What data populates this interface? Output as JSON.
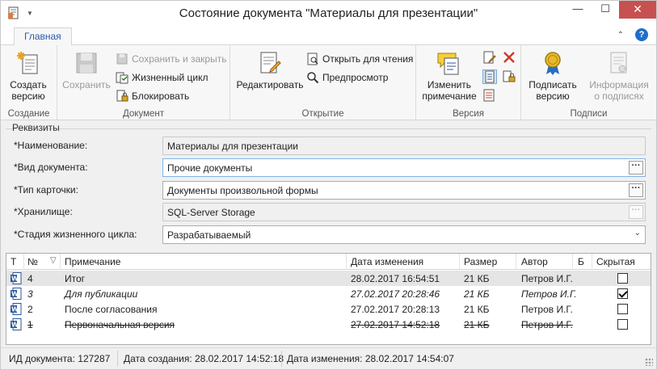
{
  "window": {
    "title": "Состояние документа \"Материалы для презентации\"",
    "minimize_glyph": "—",
    "maximize_glyph": "☐",
    "close_glyph": "✕"
  },
  "ribbon": {
    "tab_main": "Главная",
    "help_glyph": "?",
    "collapse_glyph": "⌃",
    "groups": {
      "create": "Создание",
      "document": "Документ",
      "open": "Открытие",
      "version": "Версия",
      "signatures": "Подписи"
    },
    "buttons": {
      "create_version_1": "Создать",
      "create_version_2": "версию",
      "save": "Сохранить",
      "save_and_close": "Сохранить и закрыть",
      "lifecycle": "Жизненный цикл",
      "lock": "Блокировать",
      "edit": "Редактировать",
      "open_read": "Открыть для чтения",
      "preview": "Предпросмотр",
      "change_note_1": "Изменить",
      "change_note_2": "примечание",
      "sign_1": "Подписать",
      "sign_2": "версию",
      "sign_info_1": "Информация",
      "sign_info_2": "о подписях"
    }
  },
  "requisites": {
    "caption": "Реквизиты",
    "fields": [
      {
        "label": "*Наименование:",
        "value": "Материалы для презентации"
      },
      {
        "label": "*Вид документа:",
        "value": "Прочие документы"
      },
      {
        "label": "*Тип карточки:",
        "value": "Документы произвольной формы"
      },
      {
        "label": "*Хранилище:",
        "value": "SQL-Server Storage"
      },
      {
        "label": "*Стадия жизненного цикла:",
        "value": "Разрабатываемый"
      }
    ],
    "ellipsis": "···",
    "dropdown_glyph": "⌄"
  },
  "table": {
    "columns": {
      "type": "Т",
      "num": "№",
      "sort": "▽",
      "note": "Примечание",
      "date": "Дата изменения",
      "size": "Размер",
      "author": "Автор",
      "b": "Б",
      "hidden": "Скрытая"
    },
    "rows": [
      {
        "num": "4",
        "note": "Итог",
        "date": "28.02.2017 16:54:51",
        "size": "21 КБ",
        "author": "Петров И.Г.",
        "hidden": false
      },
      {
        "num": "3",
        "note": "Для публикации",
        "date": "27.02.2017 20:28:46",
        "size": "21 КБ",
        "author": "Петров И.Г.",
        "hidden": true
      },
      {
        "num": "2",
        "note": "После согласования",
        "date": "27.02.2017 20:28:13",
        "size": "21 КБ",
        "author": "Петров И.Г.",
        "hidden": false
      },
      {
        "num": "1",
        "note": "Первоначальная версия",
        "date": "27.02.2017 14:52:18",
        "size": "21 КБ",
        "author": "Петров И.Г.",
        "hidden": false
      }
    ]
  },
  "status": {
    "doc_id": "ИД документа: 127287",
    "created": "Дата создания: 28.02.2017 14:52:18",
    "modified": "Дата изменения: 28.02.2017 14:54:07"
  },
  "colors": {
    "accent": "#2a5aa8",
    "close_red": "#c75050",
    "word_blue": "#2b579a"
  }
}
